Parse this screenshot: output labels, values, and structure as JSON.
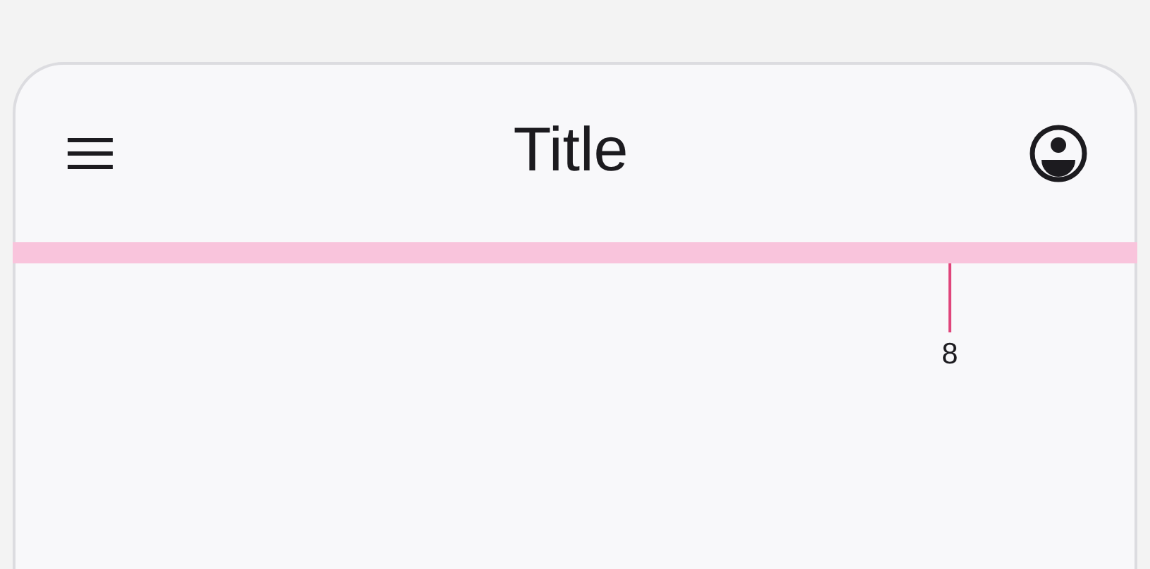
{
  "top_app_bar": {
    "title": "Title"
  },
  "spacing_annotation": {
    "label": "8"
  }
}
